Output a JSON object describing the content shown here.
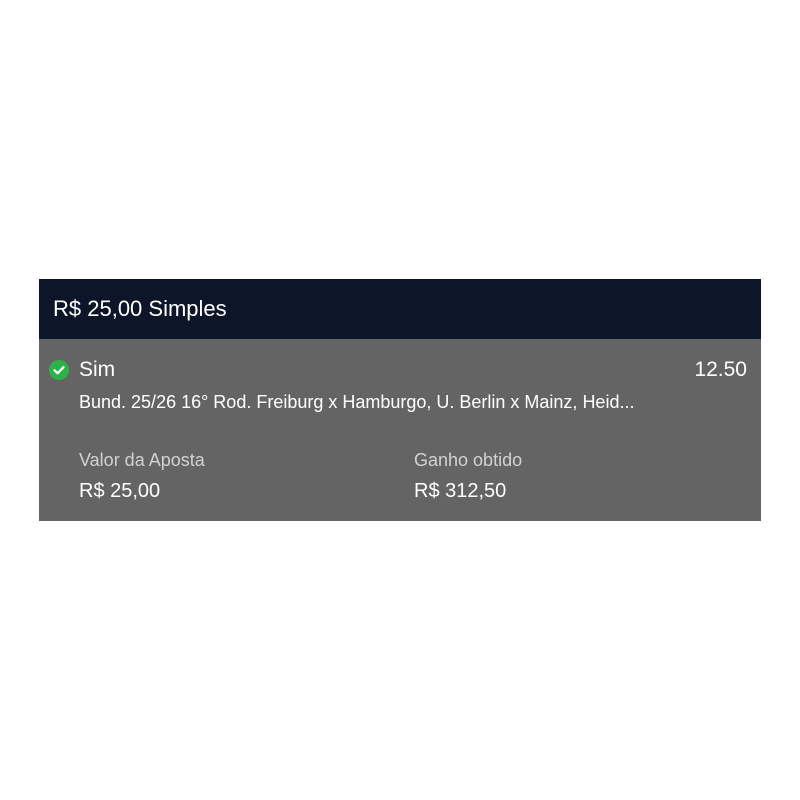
{
  "bet": {
    "header_title": "R$ 25,00 Simples",
    "selection": {
      "name": "Sim",
      "odds": "12.50",
      "status_icon": "check-circle-icon",
      "status_color": "#2bb34a"
    },
    "event_description": "Bund. 25/26 16° Rod. Freiburg x Hamburgo, U. Berlin x Mainz, Heid...",
    "stake": {
      "label": "Valor da Aposta",
      "value": "R$ 25,00"
    },
    "winnings": {
      "label": "Ganho obtido",
      "value": "R$ 312,50"
    }
  },
  "colors": {
    "header_bg": "#0d1628",
    "card_bg": "#646464",
    "text_primary": "#ffffff",
    "text_secondary": "#d2d2d2"
  }
}
